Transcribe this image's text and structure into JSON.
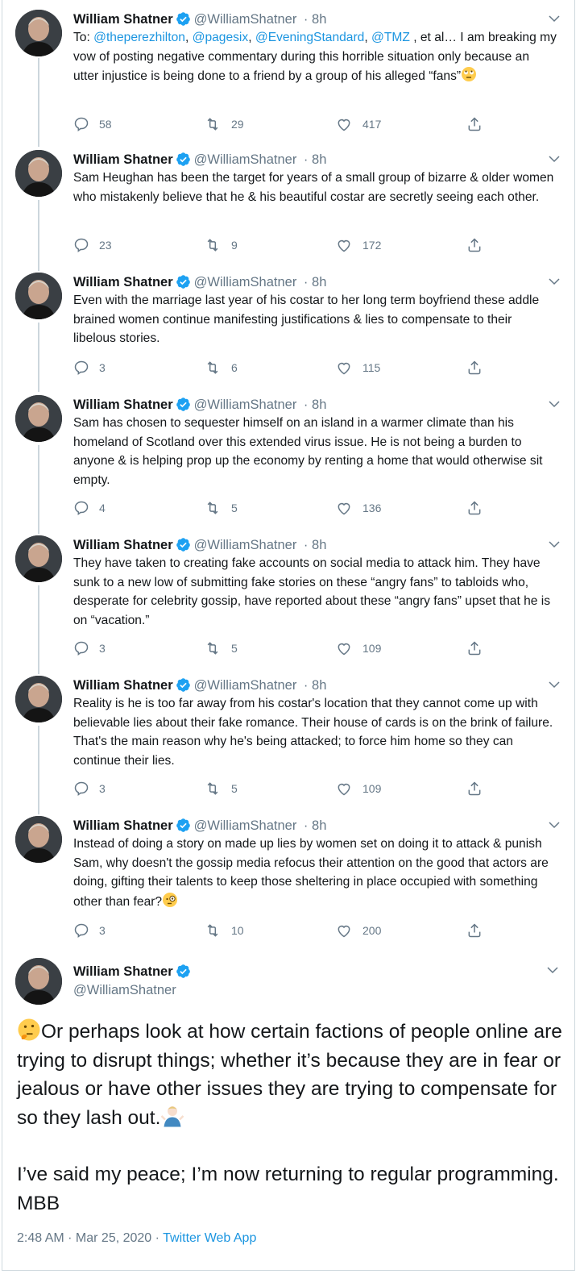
{
  "author": {
    "name": "William Shatner",
    "handle": "@WilliamShatner",
    "age": "8h"
  },
  "tweets": [
    {
      "text_prefix": "To: ",
      "mentions": [
        "@theperezhilton",
        "@pagesix",
        "@EveningStandard",
        "@TMZ"
      ],
      "text": " , et al… I am breaking my vow of posting negative commentary during this horrible situation only because an utter injustice is being done to a friend by a group of his alleged “fans”",
      "emoji": "face-with-rolling-eyes",
      "replies": "58",
      "retweets": "29",
      "likes": "417"
    },
    {
      "text": "Sam Heughan has been the target for years of a small group of bizarre & older women who mistakenly believe that he & his beautiful costar are secretly seeing each other.",
      "replies": "23",
      "retweets": "9",
      "likes": "172"
    },
    {
      "text": "Even with the marriage last year of his costar to her long term boyfriend these addle brained women continue manifesting justifications & lies to compensate to their libelous stories.",
      "replies": "3",
      "retweets": "6",
      "likes": "115"
    },
    {
      "text": "Sam has chosen to sequester himself on an island in a warmer climate than his homeland of Scotland over this extended virus issue. He is not being a burden to anyone & is helping prop up the economy by renting a home that would otherwise sit empty.",
      "replies": "4",
      "retweets": "5",
      "likes": "136"
    },
    {
      "text": "They have taken to creating fake accounts on social media to attack him. They have sunk to a new low of submitting fake stories on these “angry fans” to tabloids who, desperate for celebrity gossip, have reported about these “angry fans” upset that he is on “vacation.”",
      "replies": "3",
      "retweets": "5",
      "likes": "109"
    },
    {
      "text": "Reality is he is too far away from his costar's location that they cannot come up with believable lies about their fake romance.  Their house of cards is on the brink of failure.  That's the main reason why he's being attacked; to force him home so they can continue their lies.",
      "replies": "3",
      "retweets": "5",
      "likes": "109"
    },
    {
      "text": "Instead of doing a story on made up lies by women set on doing it to attack & punish Sam, why doesn't the gossip media refocus their attention on the good that actors  are doing, gifting their talents to keep those sheltering in place occupied with something other than fear?",
      "emoji": "face-with-monocle",
      "replies": "3",
      "retweets": "10",
      "likes": "200"
    }
  ],
  "final_tweet": {
    "para1": "Or perhaps look at how certain factions of people online are trying to disrupt things; whether it’s  because they are in fear or jealous or have other issues they are trying to compensate for so they lash out.",
    "para2": "I’ve said my peace; I’m now returning to regular programming. MBB",
    "emoji_start": "thinking-face",
    "emoji_end": "man-shrugging",
    "time": "2:48 AM · Mar 25, 2020 · ",
    "source": "Twitter Web App"
  },
  "colors": {
    "link": "#1b95e0",
    "verified": "#1da1f2",
    "muted": "#657786",
    "line": "#ccd6dd"
  }
}
